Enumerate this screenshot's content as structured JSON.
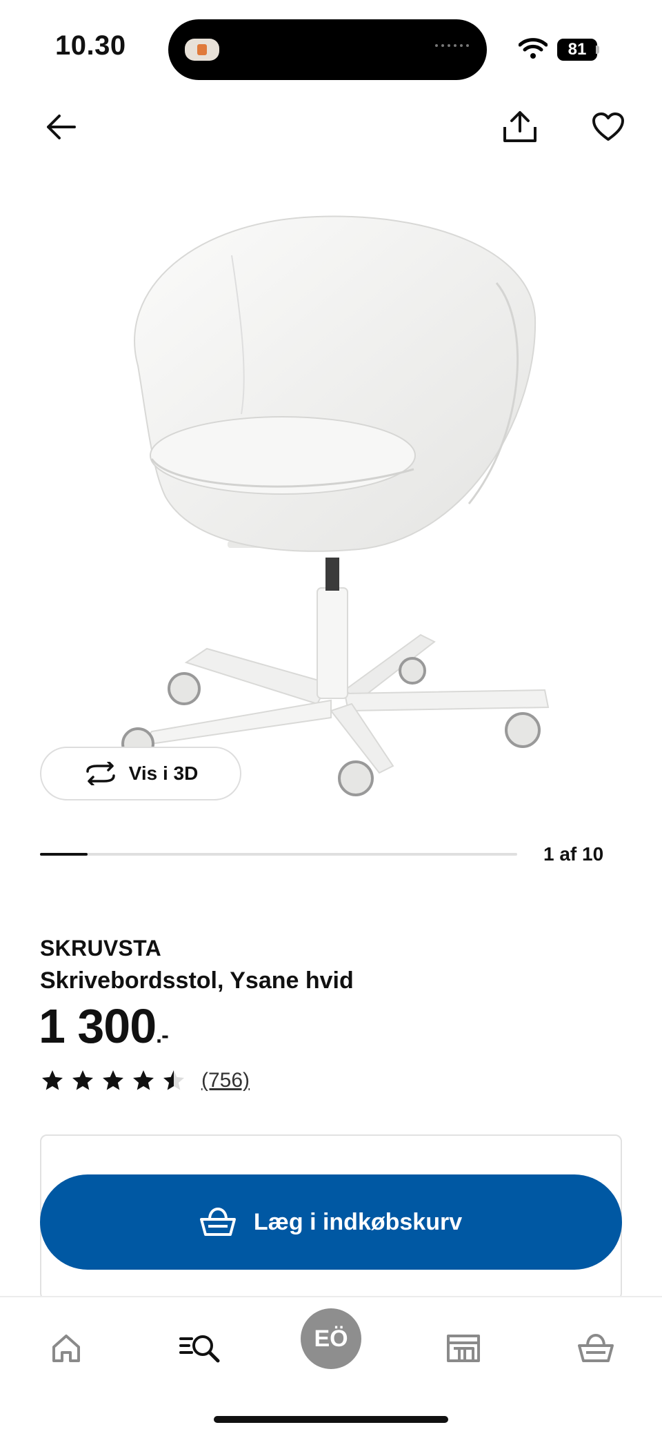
{
  "status_bar": {
    "time": "10.30",
    "battery": "81"
  },
  "header": {
    "back_icon": "arrow-left-icon",
    "share_icon": "share-icon",
    "favorite_icon": "heart-icon"
  },
  "gallery": {
    "view_3d_label": "Vis i 3D",
    "counter": "1 af 10",
    "progress": 0.1
  },
  "product": {
    "name": "SKRUVSTA",
    "description": "Skrivebordsstol, Ysane hvid",
    "price": "1 300",
    "price_suffix": ".-",
    "rating": 4.5,
    "reviews": "(756)"
  },
  "cart": {
    "button_label": "Læg i indkøbskurv"
  },
  "bottom_nav": {
    "items": [
      "home-icon",
      "search-icon",
      "profile-avatar",
      "store-icon",
      "cart-icon"
    ],
    "avatar_initials": "EÖ"
  },
  "colors": {
    "primary": "#0058a3",
    "text": "#111111"
  }
}
